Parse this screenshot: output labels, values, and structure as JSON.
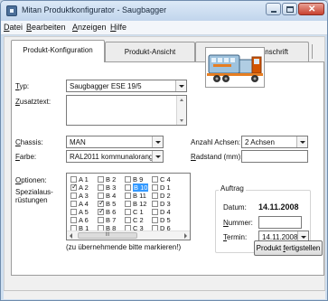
{
  "window": {
    "title": "Mitan Produktkonfigurator - Saugbagger"
  },
  "menu": [
    {
      "u": "D",
      "rest": "atei"
    },
    {
      "u": "B",
      "rest": "earbeiten"
    },
    {
      "u": "A",
      "rest": "nzeigen"
    },
    {
      "u": "H",
      "rest": "ilfe"
    }
  ],
  "tabs": [
    {
      "label": "Produkt-Konfiguration",
      "active": true
    },
    {
      "label": "Produkt-Ansicht",
      "active": false
    },
    {
      "label": "Kunde / Lieferanschrift",
      "active": false
    }
  ],
  "form": {
    "typ": {
      "u": "T",
      "rest": "yp:",
      "value": "Saugbagger ESE 19/5"
    },
    "zusatztext": {
      "u": "Z",
      "rest": "usatztext:",
      "value": ""
    },
    "chassis": {
      "u": "C",
      "rest": "hassis:",
      "value": "MAN"
    },
    "farbe": {
      "u": "F",
      "rest": "arbe:",
      "value": "RAL2011 kommunalorange"
    },
    "achsen": {
      "label": "Anzahl Achsen:",
      "value": "2 Achsen"
    },
    "radstand": {
      "u": "R",
      "rest": "adstand (mm):",
      "value": ""
    },
    "optionen": {
      "u": "O",
      "rest": "ptionen:"
    },
    "spezial_line1": "Spezialaus-",
    "spezial_line2": "rüstungen",
    "hint": "(zu übernehmende bitte markieren!)"
  },
  "options": [
    [
      "A 1",
      "A 2",
      "A 3",
      "A 4",
      "A 5",
      "A 6",
      "B 1"
    ],
    [
      "B 2",
      "B 3",
      "B 4",
      "B 5",
      "B 6",
      "B 7",
      "B 8"
    ],
    [
      "B 9",
      "B 10",
      "B 11",
      "B 12",
      "C 1",
      "C 2",
      "C 3"
    ],
    [
      "C 4",
      "D 1",
      "D 2",
      "D 3",
      "D 4",
      "D 5",
      "D 6"
    ]
  ],
  "options_checked": [
    "A 2",
    "B 5",
    "B 6"
  ],
  "options_selected": "B 10",
  "auftrag": {
    "title": "Auftrag",
    "datum_label": "Datum:",
    "datum_value": "14.11.2008",
    "nummer": {
      "u": "N",
      "rest": "ummer:",
      "value": ""
    },
    "termin": {
      "u": "T",
      "rest": "ermin:",
      "value": "14.11.2008"
    }
  },
  "scroll_thumb": "III",
  "button": {
    "u": "f",
    "pre": "Produkt ",
    "rest": "ertigstellen"
  }
}
